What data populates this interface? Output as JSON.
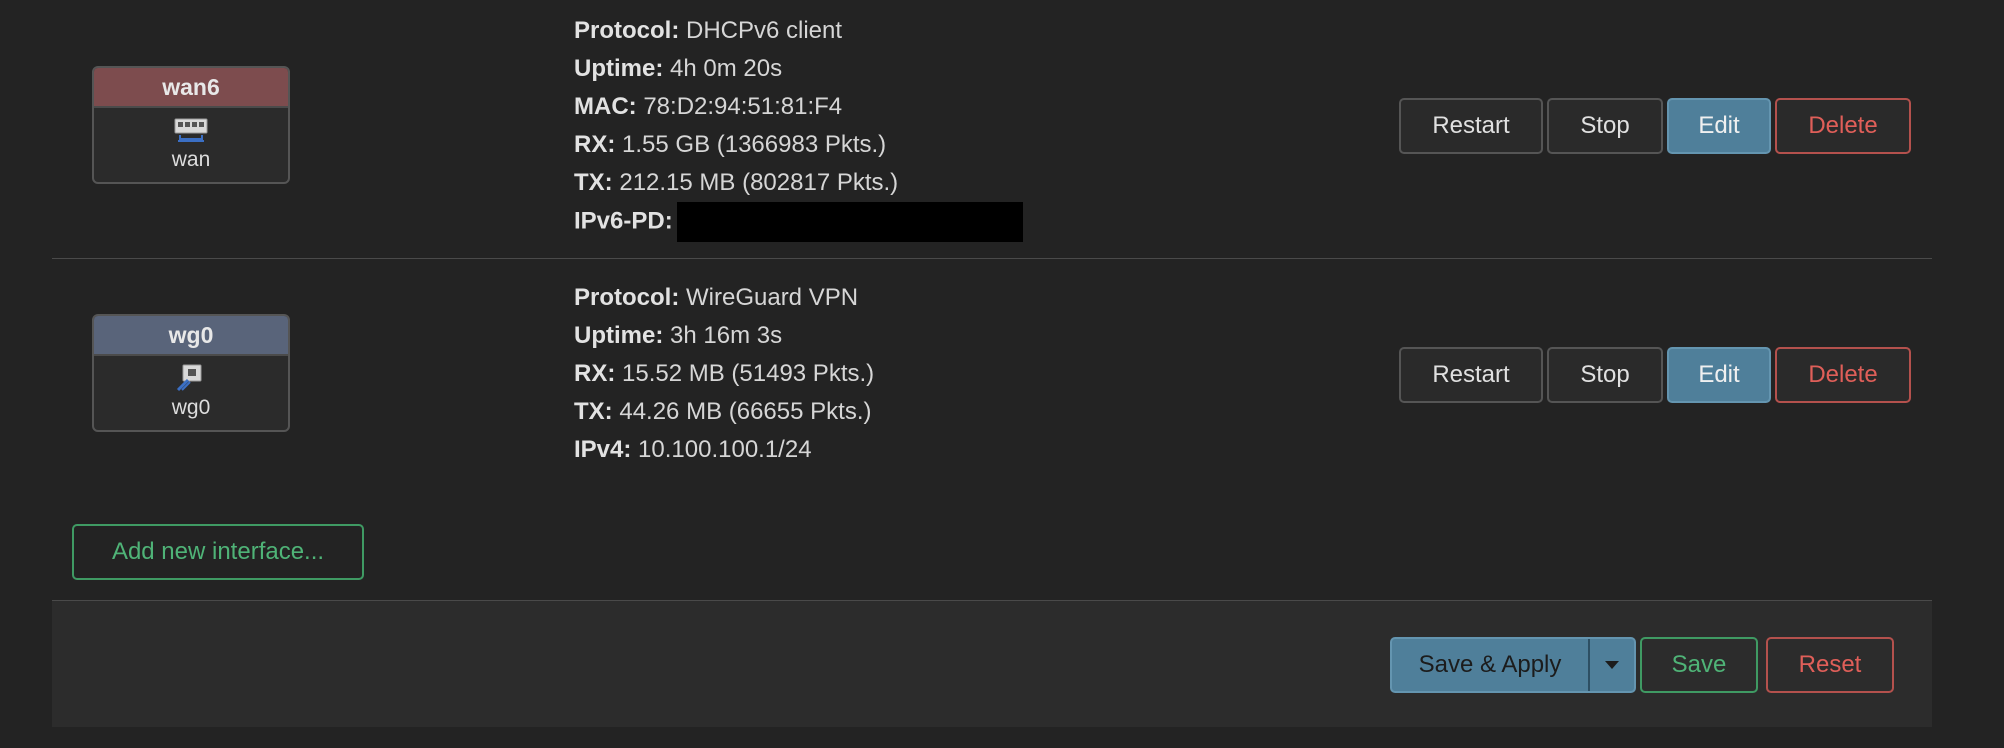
{
  "interfaces": [
    {
      "name": "wan6",
      "device": "wan",
      "header_color": "#7d4c4e",
      "icon": "ethernet-port-icon",
      "details": {
        "protocol_label": "Protocol:",
        "protocol": "DHCPv6 client",
        "uptime_label": "Uptime:",
        "uptime": "4h 0m 20s",
        "mac_label": "MAC:",
        "mac": "78:D2:94:51:81:F4",
        "rx_label": "RX:",
        "rx": "1.55 GB (1366983 Pkts.)",
        "tx_label": "TX:",
        "tx": "212.15 MB (802817 Pkts.)",
        "ipv6pd_label": "IPv6-PD:"
      }
    },
    {
      "name": "wg0",
      "device": "wg0",
      "header_color": "#59647a",
      "icon": "tunnel-interface-icon",
      "details": {
        "protocol_label": "Protocol:",
        "protocol": "WireGuard VPN",
        "uptime_label": "Uptime:",
        "uptime": "3h 16m 3s",
        "rx_label": "RX:",
        "rx": "15.52 MB (51493 Pkts.)",
        "tx_label": "TX:",
        "tx": "44.26 MB (66655 Pkts.)",
        "ipv4_label": "IPv4:",
        "ipv4": "10.100.100.1/24"
      }
    }
  ],
  "row_actions": {
    "restart": "Restart",
    "stop": "Stop",
    "edit": "Edit",
    "delete": "Delete"
  },
  "add_interface_label": "Add new interface...",
  "footer": {
    "save_apply": "Save & Apply",
    "save": "Save",
    "reset": "Reset"
  },
  "colors": {
    "background": "#232323",
    "primary": "#4f7f9a",
    "positive": "#4fb377",
    "negative": "#e05f59"
  }
}
